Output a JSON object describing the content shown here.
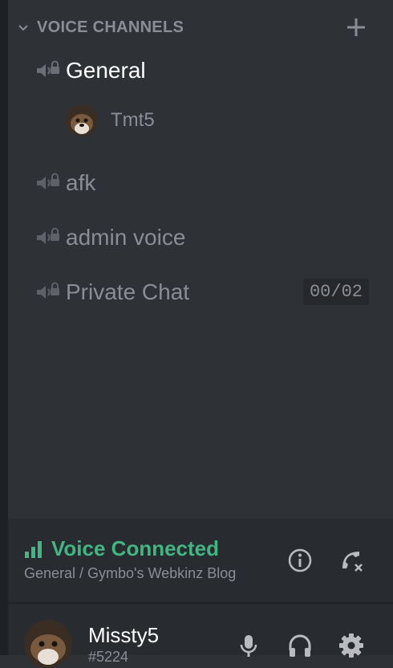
{
  "category": {
    "label": "VOICE CHANNELS",
    "collapse_icon": "chevron-down-icon",
    "add_icon": "plus-icon"
  },
  "channels": [
    {
      "name": "General",
      "active": true,
      "locked": true
    },
    {
      "name": "afk",
      "active": false,
      "locked": true
    },
    {
      "name": "admin voice",
      "active": false,
      "locked": true
    },
    {
      "name": "Private Chat",
      "active": false,
      "locked": true,
      "user_limit": "00/02"
    }
  ],
  "members": [
    {
      "name": "Tmt5",
      "channel": "General"
    }
  ],
  "voice_panel": {
    "status": "Voice Connected",
    "location": "General / Gymbo's Webkinz Blog",
    "status_color": "#43b581"
  },
  "user": {
    "name": "Missty5",
    "discriminator": "#5224"
  },
  "colors": {
    "background": "#2e3136",
    "panel": "#282b30",
    "muted_text": "#8a8e94",
    "active_text": "#ffffff",
    "connected_green": "#43b581"
  }
}
